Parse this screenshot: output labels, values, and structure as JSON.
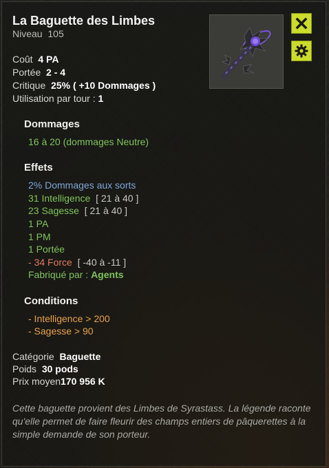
{
  "item": {
    "name": "La Baguette des Limbes",
    "level_label": "Niveau",
    "level": "105",
    "description": "Cette baguette provient des Limbes de Syrastass. La légende raconte qu'elle permet de faire fleurir des champs entiers de pâquerettes à la simple demande de son porteur."
  },
  "stats": {
    "cost_label": "Coût",
    "cost": "4 PA",
    "range_label": "Portée",
    "range": "2 - 4",
    "critical_label": "Critique",
    "critical": "25% ( +10 Dommages )",
    "uses_label": "Utilisation par tour :",
    "uses": "1"
  },
  "damage": {
    "title": "Dommages",
    "line": "16 à 20 (dommages Neutre)"
  },
  "effects": {
    "title": "Effets",
    "lines": [
      {
        "text": "2% Dommages aux sorts",
        "range": ""
      },
      {
        "text": "31 Intelligence",
        "range": "[ 21 à 40 ]"
      },
      {
        "text": "23 Sagesse",
        "range": "[ 21 à 40 ]"
      },
      {
        "text": "1 PA",
        "range": ""
      },
      {
        "text": "1 PM",
        "range": ""
      },
      {
        "text": "1 Portée",
        "range": ""
      },
      {
        "text": "- 34 Force",
        "range": "[ -40 à -11 ]"
      }
    ],
    "crafted_label": "Fabriqué par :",
    "crafted_value": "Agents"
  },
  "conditions": {
    "title": "Conditions",
    "lines": [
      "- Intelligence > 200",
      "- Sagesse > 90"
    ]
  },
  "info": {
    "category_label": "Catégorie",
    "category": "Baguette",
    "weight_label": "Poids",
    "weight": "30 pods",
    "price_label": "Prix moyen",
    "price": "170 956 K"
  },
  "buttons": {
    "close_icon": "close-icon",
    "settings_icon": "gear-icon"
  },
  "colors": {
    "accent_button": "#cbdc2a",
    "positive": "#7fc45a",
    "spell_damage": "#7ea6d8",
    "negative": "#e07a5c",
    "condition": "#e8a34a"
  }
}
